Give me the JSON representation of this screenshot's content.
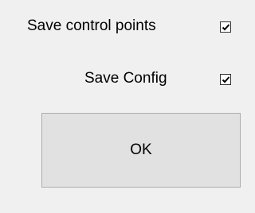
{
  "options": [
    {
      "label": "Save control points",
      "checked": true
    },
    {
      "label": "Save Config",
      "checked": true
    }
  ],
  "ok_button": {
    "label": "OK"
  },
  "icons": {
    "checkmark": "check-icon"
  },
  "colors": {
    "background": "#f0f0f0",
    "button_face": "#e1e1e1",
    "button_border": "#adadad",
    "checkbox_border": "#333333"
  }
}
